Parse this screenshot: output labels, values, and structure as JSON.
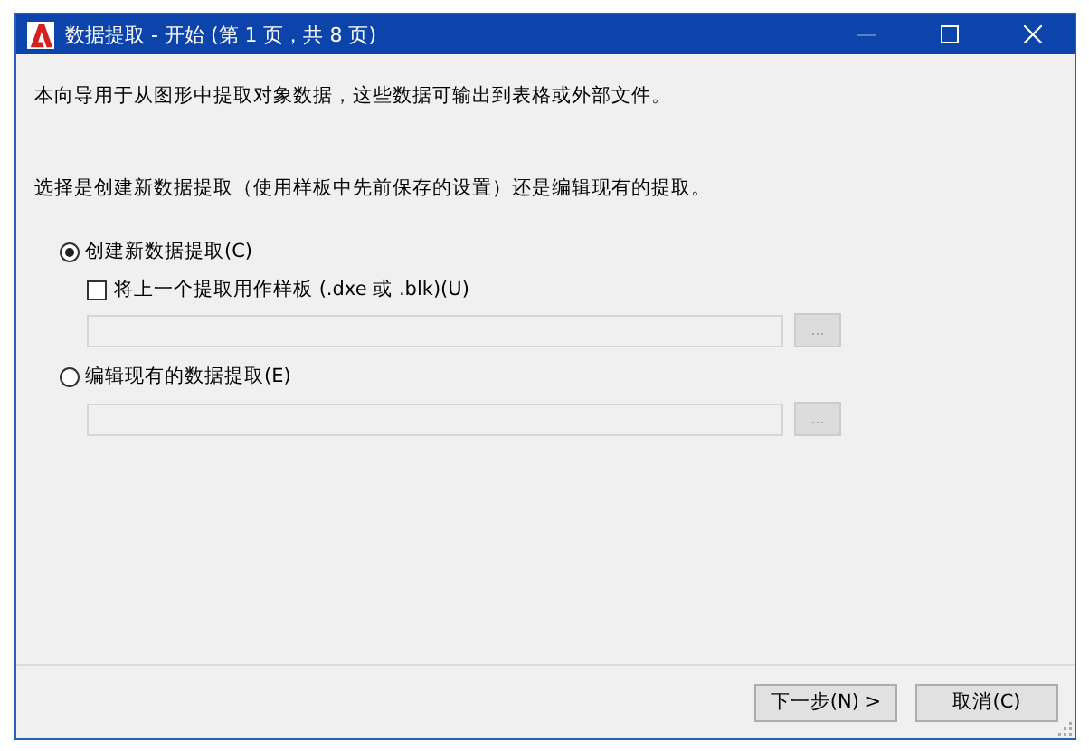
{
  "window": {
    "title": "数据提取 - 开始 (第 1 页，共 8 页)",
    "minimize_enabled": false
  },
  "intro": "本向导用于从图形中提取对象数据，这些数据可输出到表格或外部文件。",
  "prompt": "选择是创建新数据提取（使用样板中先前保存的设置）还是编辑现有的提取。",
  "options": [
    {
      "label": "创建新数据提取(C)",
      "selected": true,
      "checkbox": {
        "label": "将上一个提取用作样板  (.dxe 或 .blk)(U)",
        "checked": false
      },
      "field": {
        "disabled": true
      },
      "browse": {
        "label": "...",
        "disabled": true
      }
    },
    {
      "label": "编辑现有的数据提取(E)",
      "selected": false,
      "field": {
        "disabled": true
      },
      "browse": {
        "label": "...",
        "disabled": true
      }
    }
  ],
  "buttons": [
    {
      "label": "下一步(N) >"
    },
    {
      "label": "取消(C)"
    }
  ]
}
